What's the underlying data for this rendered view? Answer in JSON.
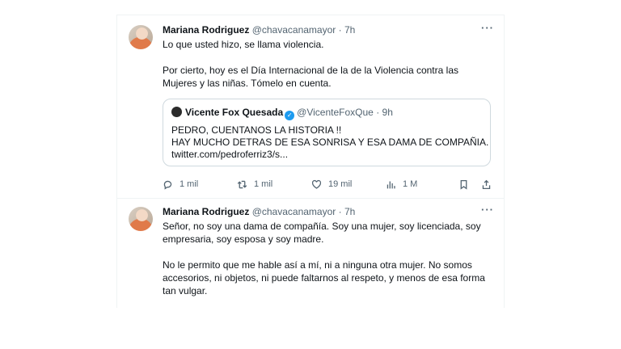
{
  "tweets": [
    {
      "author_name": "Mariana Rodriguez",
      "handle": "@chavacanamayor",
      "separator": "·",
      "time": "7h",
      "more": "···",
      "paragraphs": [
        "Lo que usted hizo, se llama violencia.",
        "Por cierto, hoy es el Día Internacional de la de la Violencia contra las Mujeres y las niñas. Tómelo en cuenta."
      ],
      "quote": {
        "author_name": "Vicente Fox Quesada",
        "handle": "@VicenteFoxQue",
        "separator": "·",
        "time": "9h",
        "lines": [
          "PEDRO, CUENTANOS LA HISTORIA !!",
          "HAY MUCHO DETRAS DE ESA SONRISA Y ESA DAMA DE COMPAÑIA.",
          "twitter.com/pedroferriz3/s..."
        ]
      },
      "actions": {
        "replies": "1 mil",
        "retweets": "1 mil",
        "likes": "19 mil",
        "views": "1 M"
      }
    },
    {
      "author_name": "Mariana Rodriguez",
      "handle": "@chavacanamayor",
      "separator": "·",
      "time": "7h",
      "more": "···",
      "paragraphs": [
        "Señor, no soy una dama de compañía. Soy una mujer, soy licenciada, soy empresaria, soy esposa y soy madre.",
        "No le permito que me hable así a mí, ni a ninguna otra mujer. No somos accesorios, ni objetos, ni puede faltarnos al respeto, y menos de esa forma tan vulgar."
      ]
    }
  ],
  "icons": {
    "reply": "reply-icon",
    "retweet": "retweet-icon",
    "like": "heart-icon",
    "views": "views-icon",
    "bookmark": "bookmark-icon",
    "share": "share-icon"
  },
  "colors": {
    "text": "#0f1419",
    "secondary": "#536471",
    "verified": "#1d9bf0",
    "border": "#cfd9de"
  }
}
